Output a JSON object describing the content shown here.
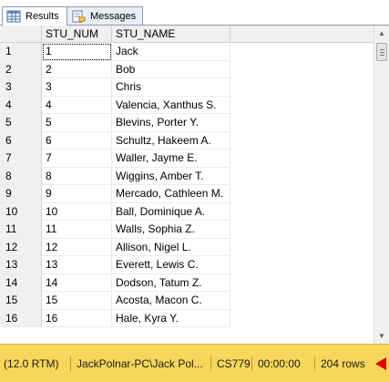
{
  "tabs": [
    {
      "label": "Results",
      "icon": "grid-icon",
      "active": true
    },
    {
      "label": "Messages",
      "icon": "messages-icon",
      "active": false
    }
  ],
  "grid": {
    "columns": [
      "",
      "STU_NUM",
      "STU_NAME"
    ],
    "rows": [
      {
        "num": "1",
        "stu_num": "1",
        "stu_name": "Jack"
      },
      {
        "num": "2",
        "stu_num": "2",
        "stu_name": "Bob"
      },
      {
        "num": "3",
        "stu_num": "3",
        "stu_name": "Chris"
      },
      {
        "num": "4",
        "stu_num": "4",
        "stu_name": "Valencia, Xanthus S."
      },
      {
        "num": "5",
        "stu_num": "5",
        "stu_name": "Blevins, Porter Y."
      },
      {
        "num": "6",
        "stu_num": "6",
        "stu_name": "Schultz, Hakeem A."
      },
      {
        "num": "7",
        "stu_num": "7",
        "stu_name": "Waller, Jayme E."
      },
      {
        "num": "8",
        "stu_num": "8",
        "stu_name": "Wiggins, Amber T."
      },
      {
        "num": "9",
        "stu_num": "9",
        "stu_name": "Mercado, Cathleen M."
      },
      {
        "num": "10",
        "stu_num": "10",
        "stu_name": "Ball, Dominique A."
      },
      {
        "num": "11",
        "stu_num": "11",
        "stu_name": "Walls, Sophia Z."
      },
      {
        "num": "12",
        "stu_num": "12",
        "stu_name": "Allison, Nigel L."
      },
      {
        "num": "13",
        "stu_num": "13",
        "stu_name": "Everett, Lewis C."
      },
      {
        "num": "14",
        "stu_num": "14",
        "stu_name": "Dodson, Tatum Z."
      },
      {
        "num": "15",
        "stu_num": "15",
        "stu_name": "Acosta, Macon C."
      },
      {
        "num": "16",
        "stu_num": "16",
        "stu_name": "Hale, Kyra Y."
      }
    ]
  },
  "status": {
    "version": "(12.0 RTM)",
    "connection": "JackPolnar-PC\\Jack Pol...",
    "database": "CS779",
    "elapsed": "00:00:00",
    "rows": "204 rows"
  },
  "colors": {
    "status_bg": "#f7d75b",
    "arrow": "#e00000"
  }
}
